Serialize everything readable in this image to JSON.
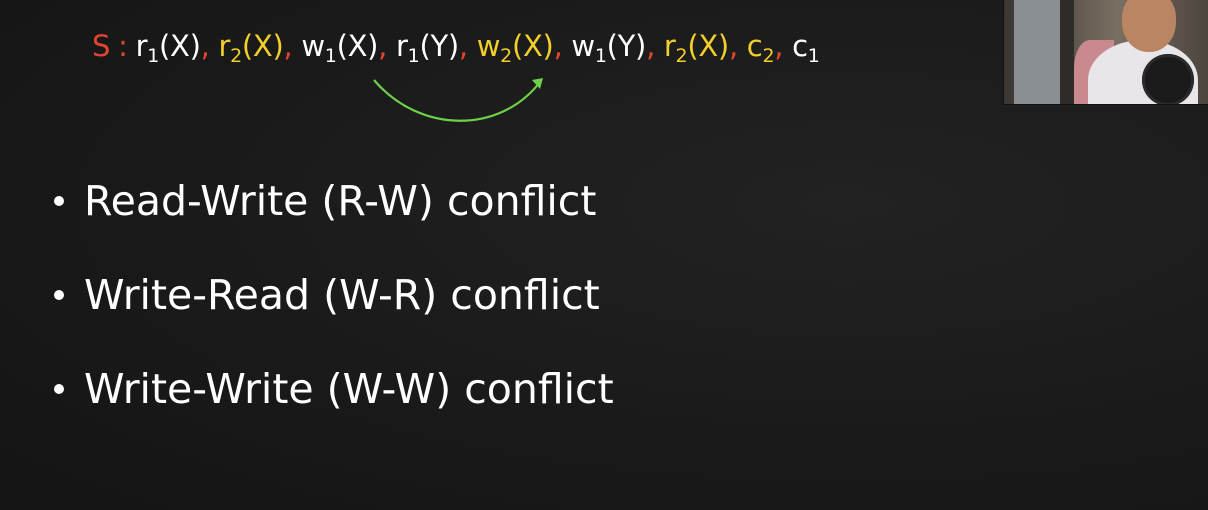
{
  "schedule": {
    "label": "S",
    "colon": ":",
    "separator": ",",
    "operations": [
      {
        "op": "r",
        "sub": "1",
        "arg": "(X)",
        "txn": 1
      },
      {
        "op": "r",
        "sub": "2",
        "arg": "(X)",
        "txn": 2
      },
      {
        "op": "w",
        "sub": "1",
        "arg": "(X)",
        "txn": 1
      },
      {
        "op": "r",
        "sub": "1",
        "arg": "(Y)",
        "txn": 1
      },
      {
        "op": "w",
        "sub": "2",
        "arg": "(X)",
        "txn": 2
      },
      {
        "op": "w",
        "sub": "1",
        "arg": "(Y)",
        "txn": 1
      },
      {
        "op": "r",
        "sub": "2",
        "arg": "(X)",
        "txn": 2
      },
      {
        "op": "c",
        "sub": "2",
        "arg": "",
        "txn": 2
      },
      {
        "op": "c",
        "sub": "1",
        "arg": "",
        "txn": 1
      }
    ]
  },
  "bullets": [
    "Read-Write (R-W) conflict",
    "Write-Read (W-R) conflict",
    "Write-Write (W-W) conflict"
  ],
  "colors": {
    "txn1": "#ffffff",
    "txn2": "#f2cf2a",
    "label": "#e2452f",
    "arrow": "#6fd14a",
    "background": "#1a1a1a"
  },
  "icons": {
    "arrow": "curved-arrow-icon",
    "bullet": "bullet-dot-icon"
  }
}
